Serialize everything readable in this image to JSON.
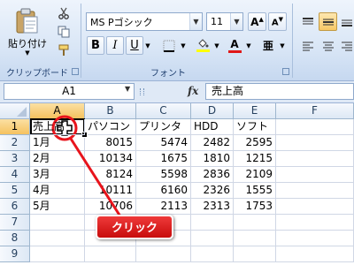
{
  "ribbon": {
    "clipboard": {
      "paste_label": "貼り付け",
      "group_label": "クリップボード"
    },
    "font": {
      "font_name": "MS Pゴシック",
      "font_size": "11",
      "group_label": "フォント",
      "bold": "B",
      "italic": "I",
      "underline": "U",
      "font_color_glyph": "A"
    }
  },
  "formula": {
    "name_box": "A1",
    "fx": "fx",
    "content": "売上高"
  },
  "columns": [
    "A",
    "B",
    "C",
    "D",
    "E",
    "F"
  ],
  "rows": [
    "1",
    "2",
    "3",
    "4",
    "5",
    "6",
    "7",
    "8",
    "9"
  ],
  "sheet": {
    "header": [
      "売上高",
      "パソコン",
      "プリンタ",
      "HDD",
      "ソフト"
    ],
    "data": [
      [
        "1月",
        "8015",
        "5474",
        "2482",
        "2595"
      ],
      [
        "2月",
        "10134",
        "1675",
        "1810",
        "1215"
      ],
      [
        "3月",
        "8124",
        "5598",
        "2836",
        "2109"
      ],
      [
        "4月",
        "10111",
        "6160",
        "2326",
        "1555"
      ],
      [
        "5月",
        "10706",
        "2113",
        "2313",
        "1753"
      ]
    ]
  },
  "annotation": {
    "callout": "クリック",
    "color": "#e8141c"
  }
}
